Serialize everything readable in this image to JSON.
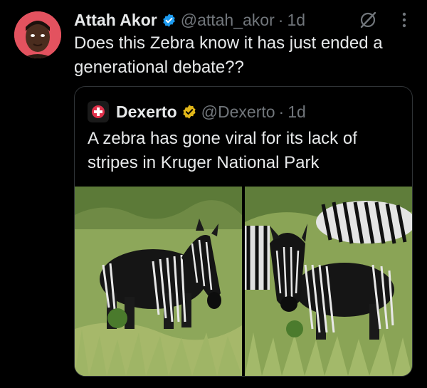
{
  "tweet": {
    "author_name": "Attah Akor",
    "handle": "@attah_akor",
    "separator": "·",
    "time": "1d",
    "text": "Does this Zebra know it has just ended a generational debate??"
  },
  "quoted": {
    "author_name": "Dexerto",
    "handle": "@Dexerto",
    "separator": "·",
    "time": "1d",
    "text": "A zebra has gone viral for its lack of stripes in Kruger National Park"
  },
  "colors": {
    "background": "#000000",
    "text": "#e7e9ea",
    "muted": "#71767b",
    "verified_blue": "#1d9bf0",
    "verified_gold": "#e2b719",
    "quote_border": "#2f3336"
  },
  "icons": {
    "verified": "verified-badge-blue",
    "org_verified": "verified-badge-gold",
    "grok": "grok-icon",
    "more": "more-vertical-icon"
  }
}
